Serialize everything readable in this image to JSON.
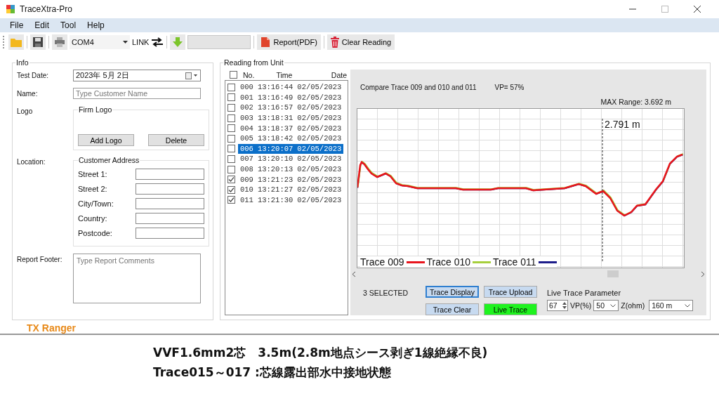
{
  "window": {
    "title": "TraceXtra-Pro"
  },
  "menu": [
    "File",
    "Edit",
    "Tool",
    "Help"
  ],
  "toolbar": {
    "port": "COM4",
    "link_label": "LINK",
    "report_button": "Report(PDF)",
    "clear_button": "Clear Reading"
  },
  "info": {
    "title": "Info",
    "fields": [
      {
        "label": "Test Date:",
        "value": "2023年 5月 2日"
      },
      {
        "label": "Name:",
        "placeholder": "Type Customer Name"
      }
    ],
    "logo_label": "Logo",
    "logo_group": "Firm Logo",
    "logo_buttons": [
      "Add Logo",
      "Delete"
    ],
    "location_label": "Location:",
    "address_group": "Customer Address",
    "address_fields": [
      "Street 1:",
      "Street 2:",
      "City/Town:",
      "Country:",
      "Postcode:"
    ],
    "footer_label": "Report Footer:",
    "footer_placeholder": "Type Report Comments"
  },
  "readings": {
    "title": "Reading from Unit",
    "select_all_checked": false,
    "columns": [
      "No.",
      "Time",
      "Date"
    ],
    "rows": [
      {
        "no": "000",
        "time": "13:16:44",
        "date": "02/05/2023",
        "checked": false,
        "selected": false
      },
      {
        "no": "001",
        "time": "13:16:49",
        "date": "02/05/2023",
        "checked": false,
        "selected": false
      },
      {
        "no": "002",
        "time": "13:16:57",
        "date": "02/05/2023",
        "checked": false,
        "selected": false
      },
      {
        "no": "003",
        "time": "13:18:31",
        "date": "02/05/2023",
        "checked": false,
        "selected": false
      },
      {
        "no": "004",
        "time": "13:18:37",
        "date": "02/05/2023",
        "checked": false,
        "selected": false
      },
      {
        "no": "005",
        "time": "13:18:42",
        "date": "02/05/2023",
        "checked": false,
        "selected": false
      },
      {
        "no": "006",
        "time": "13:20:07",
        "date": "02/05/2023",
        "checked": false,
        "selected": true
      },
      {
        "no": "007",
        "time": "13:20:10",
        "date": "02/05/2023",
        "checked": false,
        "selected": false
      },
      {
        "no": "008",
        "time": "13:20:13",
        "date": "02/05/2023",
        "checked": false,
        "selected": false
      },
      {
        "no": "009",
        "time": "13:21:23",
        "date": "02/05/2023",
        "checked": true,
        "selected": false
      },
      {
        "no": "010",
        "time": "13:21:27",
        "date": "02/05/2023",
        "checked": true,
        "selected": false
      },
      {
        "no": "011",
        "time": "13:21:30",
        "date": "02/05/2023",
        "checked": true,
        "selected": false
      }
    ]
  },
  "trace_view": {
    "compare_text": "Compare Trace 009 and 010 and 011",
    "vp_text": "VP= 57%",
    "max_range": "MAX Range: 3.692 m",
    "cursor_reading": "2.791 m",
    "traces": [
      {
        "label": "Trace 009",
        "color": "#e8141c"
      },
      {
        "label": "Trace 010",
        "color": "#a6cf3c"
      },
      {
        "label": "Trace 011",
        "color": "#1c1c8a"
      }
    ]
  },
  "controls": {
    "selected_count": "3 SELECTED",
    "buttons": [
      {
        "label": "Trace Display",
        "focused": true,
        "on": false
      },
      {
        "label": "Trace Upload",
        "focused": false,
        "on": false
      },
      {
        "label": "Trace Clear",
        "focused": false,
        "on": false
      },
      {
        "label": "Live Trace",
        "focused": false,
        "on": true
      }
    ],
    "live_title": "Live Trace Parameter",
    "vp_value": "67",
    "vp_label": "VP(%)",
    "z_value": "50",
    "z_label": "Z(ohm)",
    "range_value": "160 m"
  },
  "brand": "TX Ranger",
  "caption": [
    "VVF1.6mm2芯　3.5m(2.8m地点シース剥ぎ1線絶縁不良)",
    "Trace015～017 :芯線露出部水中接地状態"
  ]
}
